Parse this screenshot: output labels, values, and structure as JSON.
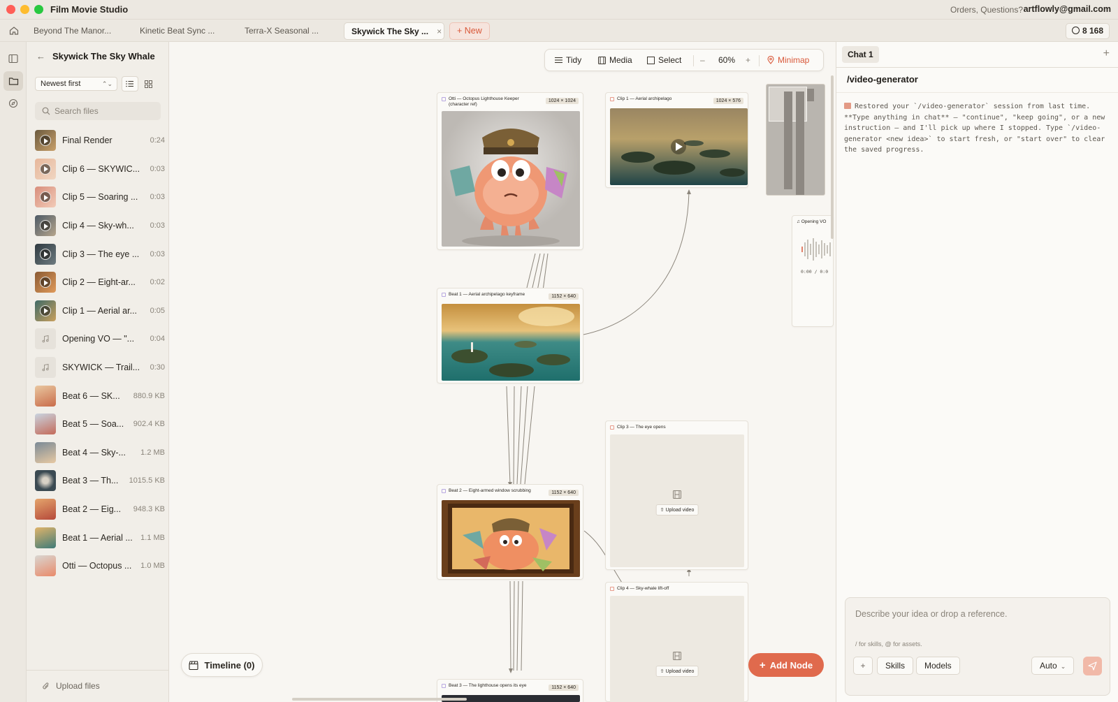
{
  "app": {
    "title": "Film Movie Studio",
    "orders_text": "Orders, Questions?",
    "account_email": "artflowly@gmail.com"
  },
  "tabs": [
    {
      "label": "Beyond The Manor..."
    },
    {
      "label": "Kinetic Beat Sync ..."
    },
    {
      "label": "Terra-X Seasonal ..."
    },
    {
      "label": "Skywick The Sky ...",
      "active": true
    }
  ],
  "new_tab_label": "+ New",
  "credits": "8 168",
  "sidebar": {
    "project_title": "Skywick The Sky Whale",
    "sort_value": "Newest first",
    "search_placeholder": "Search files",
    "files": [
      {
        "name": "Final Render",
        "meta": "0:24",
        "kind": "video"
      },
      {
        "name": "Clip 6 — SKYWIC...",
        "meta": "0:03",
        "kind": "video"
      },
      {
        "name": "Clip 5 — Soaring ...",
        "meta": "0:03",
        "kind": "video"
      },
      {
        "name": "Clip 4 — Sky-wh...",
        "meta": "0:03",
        "kind": "video"
      },
      {
        "name": "Clip 3 — The eye ...",
        "meta": "0:03",
        "kind": "video"
      },
      {
        "name": "Clip 2 — Eight-ar...",
        "meta": "0:02",
        "kind": "video"
      },
      {
        "name": "Clip 1 — Aerial ar...",
        "meta": "0:05",
        "kind": "video"
      },
      {
        "name": "Opening VO — \"...",
        "meta": "0:04",
        "kind": "audio"
      },
      {
        "name": "SKYWICK — Trail...",
        "meta": "0:30",
        "kind": "audio"
      },
      {
        "name": "Beat 6 — SK...",
        "meta": "880.9 KB",
        "kind": "image"
      },
      {
        "name": "Beat 5 — Soa...",
        "meta": "902.4 KB",
        "kind": "image"
      },
      {
        "name": "Beat 4 — Sky-...",
        "meta": "1.2 MB",
        "kind": "image"
      },
      {
        "name": "Beat 3 — Th...",
        "meta": "1015.5 KB",
        "kind": "image"
      },
      {
        "name": "Beat 2 — Eig...",
        "meta": "948.3 KB",
        "kind": "image"
      },
      {
        "name": "Beat 1 — Aerial ...",
        "meta": "1.1 MB",
        "kind": "image"
      },
      {
        "name": "Otti — Octopus ...",
        "meta": "1.0 MB",
        "kind": "image"
      }
    ],
    "upload_label": "Upload files"
  },
  "toolbar": {
    "tidy": "Tidy",
    "media": "Media",
    "select": "Select",
    "zoom": "60%",
    "minimap": "Minimap"
  },
  "nodes": {
    "otti": {
      "title": "Otti — Octopus Lighthouse Keeper (character ref)",
      "dims": "1024 × 1024"
    },
    "clip1": {
      "title": "Clip 1 — Aerial archipelago",
      "dims": "1024 × 576"
    },
    "beat1": {
      "title": "Beat 1 — Aerial archipelago keyframe",
      "dims": "1152 × 640"
    },
    "beat2": {
      "title": "Beat 2 — Eight-armed window scrubbing",
      "dims": "1152 × 640"
    },
    "beat3": {
      "title": "Beat 3 — The lighthouse opens its eye",
      "dims": "1152 × 640"
    },
    "clip3": {
      "title": "Clip 3 — The eye opens",
      "upload": "Upload video"
    },
    "clip4": {
      "title": "Clip 4 — Sky-whale lift-off",
      "upload": "Upload video"
    },
    "vo": {
      "title": "Opening VO",
      "time": "0:00 / 0:0"
    }
  },
  "canvas": {
    "timeline_label": "Timeline (0)",
    "add_node_label": "Add Node"
  },
  "chat": {
    "tab_label": "Chat 1",
    "command": "/video-generator",
    "message": "Restored your `/video-generator` session from last time. **Type anything in chat** — \"continue\", \"keep going\", or a new instruction — and I'll pick up where I stopped. Type `/video-generator <new idea>` to start fresh, or \"start over\" to clear the saved progress.",
    "placeholder": "Describe your idea or drop a reference.",
    "hint": "/ for skills, @ for assets.",
    "skills_label": "Skills",
    "models_label": "Models",
    "auto_label": "Auto"
  }
}
